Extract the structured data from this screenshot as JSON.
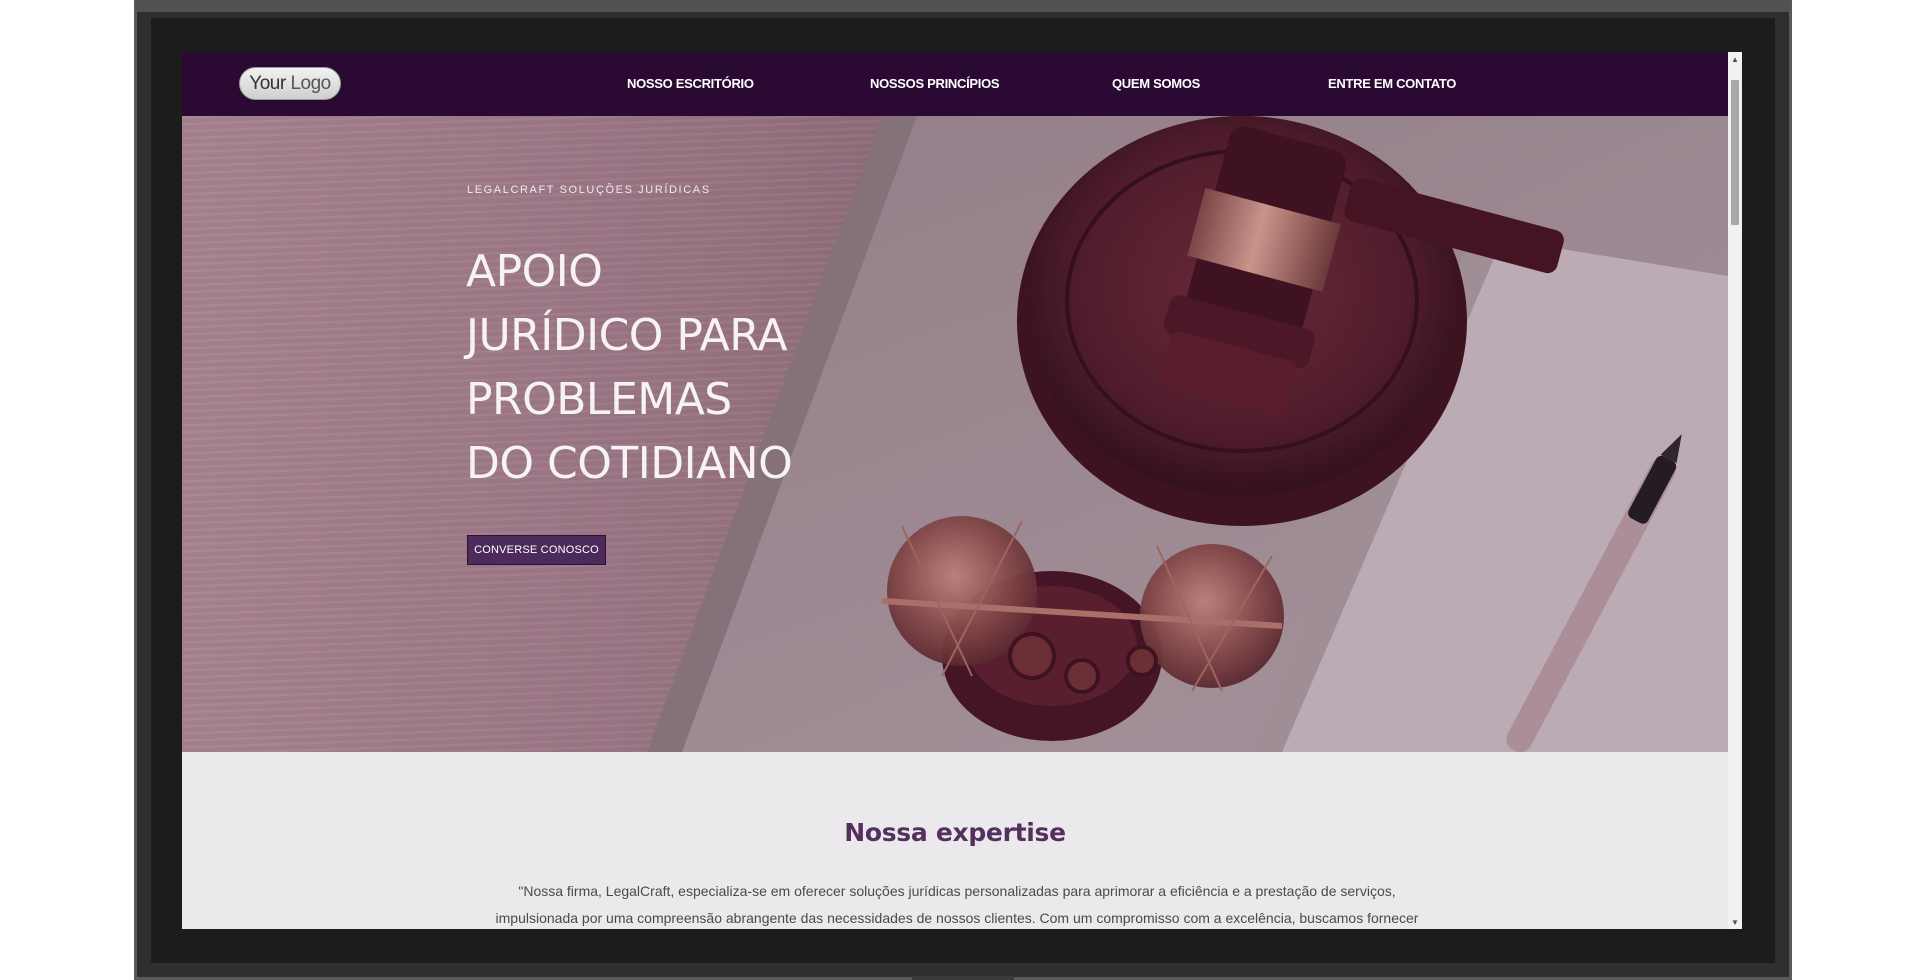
{
  "nav": {
    "logo": {
      "strong": "Your",
      "light": "Logo"
    },
    "items": [
      {
        "label": "NOSSO ESCRITÓRIO"
      },
      {
        "label": "NOSSOS PRINCÍPIOS"
      },
      {
        "label": "QUEM SOMOS"
      },
      {
        "label": "ENTRE EM CONTATO"
      }
    ]
  },
  "hero": {
    "eyebrow": "LEGALCRAFT SOLUÇÕES JURÍDICAS",
    "title_lines": [
      "APOIO",
      "JURÍDICO PARA",
      "PROBLEMAS",
      "DO COTIDIANO"
    ],
    "cta": "CONVERSE CONOSCO"
  },
  "expertise": {
    "title": "Nossa expertise",
    "text": "\"Nossa firma, LegalCraft, especializa-se em oferecer soluções jurídicas personalizadas para aprimorar a eficiência e a prestação de serviços, impulsionada por uma compreensão abrangente das necessidades de nossos clientes. Com um compromisso com a excelência, buscamos fornecer serviços jurídicos"
  },
  "colors": {
    "nav_bg": "#2a0a32",
    "accent": "#4d2a5c",
    "heading": "#54305f",
    "section_bg": "#ece9ec"
  },
  "icons": {
    "scroll_up": "scroll-up-arrow-icon",
    "scroll_down": "scroll-down-arrow-icon"
  }
}
